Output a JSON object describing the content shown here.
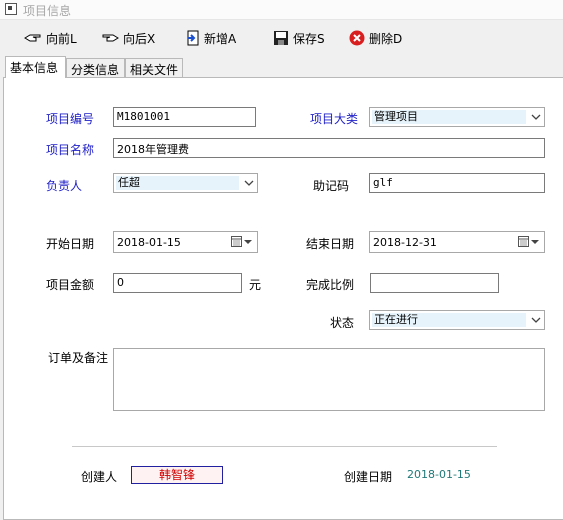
{
  "window": {
    "title": "项目信息"
  },
  "toolbar": {
    "prev_label": "向前L",
    "next_label": "向后X",
    "new_label": "新增A",
    "save_label": "保存S",
    "delete_label": "删除D"
  },
  "tabs": [
    "基本信息",
    "分类信息",
    "相关文件"
  ],
  "form": {
    "project_no_label": "项目编号",
    "project_no_value": "M1801001",
    "category_label": "项目大类",
    "category_value": "管理项目",
    "project_name_label": "项目名称",
    "project_name_value": "2018年管理费",
    "owner_label": "负责人",
    "owner_value": "任超",
    "mnemonic_label": "助记码",
    "mnemonic_value": "glf",
    "start_date_label": "开始日期",
    "start_date_value": "2018-01-15",
    "end_date_label": "结束日期",
    "end_date_value": "2018-12-31",
    "amount_label": "项目金额",
    "amount_value": "0",
    "amount_unit": "元",
    "ratio_label": "完成比例",
    "ratio_value": "",
    "status_label": "状态",
    "status_value": "正在进行",
    "notes_label": "订单及备注",
    "notes_value": ""
  },
  "footer": {
    "creator_label": "创建人",
    "creator_value": "韩智锋",
    "created_date_label": "创建日期",
    "created_date_value": "2018-01-15"
  },
  "colors": {
    "required_label": "#2020c8",
    "creator_text": "#d00000",
    "date_text": "#207878"
  }
}
